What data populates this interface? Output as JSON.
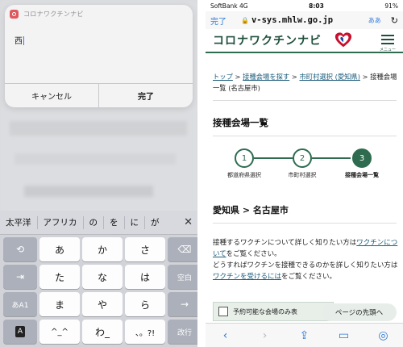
{
  "left": {
    "alert": {
      "app_name": "コロナワクチンナビ",
      "input_value": "西",
      "cancel_label": "キャンセル",
      "done_label": "完了"
    },
    "keyboard": {
      "candidates": [
        "太平洋",
        "アフリカ",
        "の",
        "を",
        "に",
        "が"
      ],
      "close_glyph": "✕",
      "keys": [
        {
          "name": "undo-key",
          "label": "⟲",
          "fn": true
        },
        {
          "name": "key-a",
          "label": "あ"
        },
        {
          "name": "key-ka",
          "label": "か"
        },
        {
          "name": "key-sa",
          "label": "さ"
        },
        {
          "name": "delete-key",
          "label": "⌫",
          "fn": true
        },
        {
          "name": "next-candidate-key",
          "label": "⇥",
          "fn": true
        },
        {
          "name": "key-ta",
          "label": "た"
        },
        {
          "name": "key-na",
          "label": "な"
        },
        {
          "name": "key-ha",
          "label": "は"
        },
        {
          "name": "space-key",
          "label": "空白",
          "fn": true
        },
        {
          "name": "mode-key",
          "label": "あA1",
          "fn": true
        },
        {
          "name": "key-ma",
          "label": "ま"
        },
        {
          "name": "key-ya",
          "label": "や"
        },
        {
          "name": "key-ra",
          "label": "ら"
        },
        {
          "name": "right-arrow-key",
          "label": "→",
          "fn": true
        },
        {
          "name": "globe-key",
          "label": "A",
          "fn": true,
          "box": true
        },
        {
          "name": "key-emoticon",
          "label": "^_^"
        },
        {
          "name": "key-wa",
          "label": "わ_"
        },
        {
          "name": "key-punct",
          "label": "、。?!"
        },
        {
          "name": "return-key",
          "label": "改行",
          "fn": true
        }
      ]
    }
  },
  "right": {
    "status": {
      "carrier": "SoftBank  4G",
      "time": "8:03",
      "battery": "91%"
    },
    "urlbar": {
      "done_label": "完了",
      "url": "v-sys.mhlw.go.jp",
      "aa_label": "ああ"
    },
    "site": {
      "logo": "コロナワクチンナビ",
      "menu_label": "メニュー"
    },
    "breadcrumb": {
      "top": "トップ",
      "sep1": " > ",
      "search": "接種会場を探す",
      "sep2": " > ",
      "muni": "市町村選択 (愛知県)",
      "rest": " > 接種会場一覧 (名古屋市)"
    },
    "page_title": "接種会場一覧",
    "steps": [
      {
        "num": "1",
        "label": "都道府県選択"
      },
      {
        "num": "2",
        "label": "市町村選択"
      },
      {
        "num": "3",
        "label": "接種会場一覧"
      }
    ],
    "region": "愛知県 > 名古屋市",
    "para": {
      "t1": "接種するワクチンについて詳しく知りたい方は",
      "l1": "ワクチンについて",
      "t2": "をご覧ください。",
      "t3": "どうすればワクチンを接種できるのかを詳しく知りたい方は",
      "l2": "ワクチンを受けるには",
      "t4": "をご覧ください。"
    },
    "filter_label": "予約可能な会場のみ表",
    "to_top_label": "ページの先頭へ",
    "accent_color": "#2e6b4f"
  }
}
